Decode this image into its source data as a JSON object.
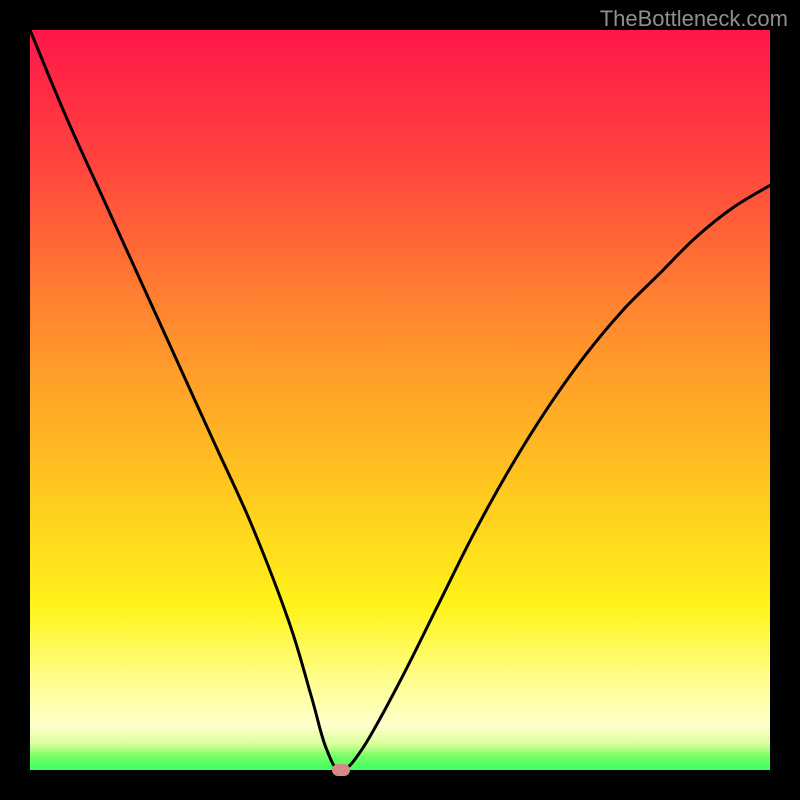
{
  "watermark": "TheBottleneck.com",
  "chart_data": {
    "type": "line",
    "title": "",
    "xlabel": "",
    "ylabel": "",
    "xlim": [
      0,
      100
    ],
    "ylim": [
      0,
      100
    ],
    "grid": false,
    "legend": false,
    "marker": {
      "x": 42,
      "y": 0,
      "color": "#d58a86"
    },
    "series": [
      {
        "name": "bottleneck-curve",
        "x": [
          0,
          5,
          10,
          15,
          20,
          25,
          30,
          35,
          38,
          40,
          42,
          45,
          50,
          55,
          60,
          65,
          70,
          75,
          80,
          85,
          90,
          95,
          100
        ],
        "values": [
          100,
          88,
          77,
          66,
          55,
          44,
          33,
          20,
          10,
          3,
          0,
          3,
          12,
          22,
          32,
          41,
          49,
          56,
          62,
          67,
          72,
          76,
          79
        ]
      }
    ],
    "background_gradient": {
      "direction": "top-to-bottom",
      "stops": [
        {
          "pos": 0.0,
          "color": "#ff164a"
        },
        {
          "pos": 0.2,
          "color": "#ff4a3c"
        },
        {
          "pos": 0.4,
          "color": "#ff8c2e"
        },
        {
          "pos": 0.6,
          "color": "#ffc220"
        },
        {
          "pos": 0.78,
          "color": "#fff31a"
        },
        {
          "pos": 0.88,
          "color": "#ffff8e"
        },
        {
          "pos": 0.94,
          "color": "#ffffcc"
        },
        {
          "pos": 0.965,
          "color": "#d8ff9a"
        },
        {
          "pos": 0.98,
          "color": "#7cff66"
        },
        {
          "pos": 1.0,
          "color": "#3eff60"
        }
      ]
    }
  }
}
